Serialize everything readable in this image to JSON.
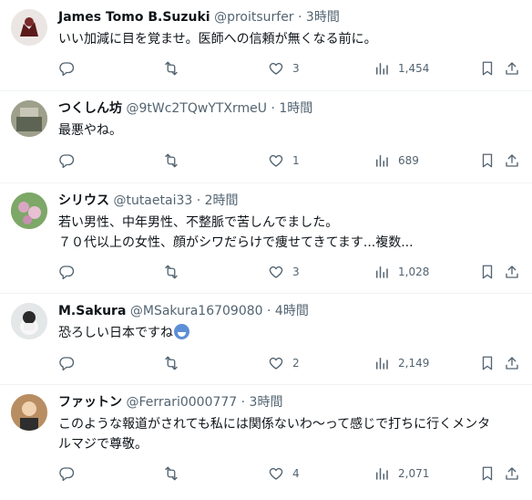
{
  "tweets": [
    {
      "name": "James Tomo B.Suzuki",
      "handle": "@proitsurfer",
      "time": "· 3時間",
      "lines": [
        "いい加減に目を覚ませ。医師への信頼が無くなる前に。"
      ],
      "likes": "3",
      "views": "1,454"
    },
    {
      "name": "つくしん坊",
      "handle": "@9tWc2TQwYTXrmeU",
      "time": "· 1時間",
      "lines": [
        "最悪やね。"
      ],
      "likes": "1",
      "views": "689"
    },
    {
      "name": "シリウス",
      "handle": "@tutaetai33",
      "time": "· 2時間",
      "lines": [
        "若い男性、中年男性、不整脈で苦しんでました。",
        "７０代以上の女性、顔がシワだらけで痩せてきてます...複数..."
      ],
      "likes": "3",
      "views": "1,028"
    },
    {
      "name": "M.Sakura",
      "handle": "@MSakura16709080",
      "time": "· 4時間",
      "lines": [
        "恐ろしい日本ですね"
      ],
      "likes": "2",
      "views": "2,149"
    },
    {
      "name": "ファットン",
      "handle": "@Ferrari0000777",
      "time": "· 3時間",
      "lines": [
        "このような報道がされても私には関係ないわ～って感じで打ちに行くメンタ",
        "ルマジで尊敬。"
      ],
      "likes": "4",
      "views": "2,071"
    }
  ],
  "colors": {
    "text": "#0f1419",
    "secondary": "#536471",
    "divider": "#eff3f4"
  }
}
